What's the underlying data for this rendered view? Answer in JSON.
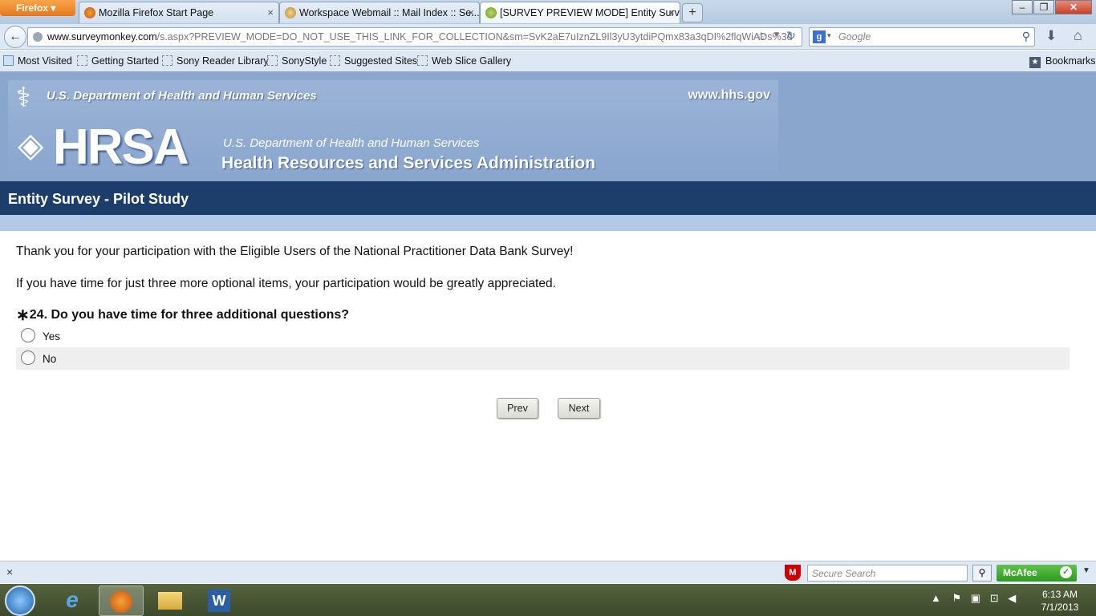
{
  "browser": {
    "menu_button": "Firefox",
    "tabs": [
      {
        "title": "Mozilla Firefox Start Page"
      },
      {
        "title": "Workspace Webmail :: Mail Index :: Se..."
      },
      {
        "title": "[SURVEY PREVIEW MODE] Entity Surv..."
      }
    ],
    "url_host": "www.surveymonkey.com",
    "url_path": "/s.aspx?PREVIEW_MODE=DO_NOT_USE_THIS_LINK_FOR_COLLECTION&sm=SvK2aE7uIznZL9Il3yU3ytdiPQmx83a3qDI%2flqWiADs%3d",
    "search_placeholder": "Google",
    "bookmarks": [
      "Most Visited",
      "Getting Started",
      "Sony Reader Library",
      "SonyStyle",
      "Suggested Sites",
      "Web Slice Gallery"
    ],
    "bookmarks_menu": "Bookmarks"
  },
  "header": {
    "dept": "U.S. Department of Health and Human Services",
    "site": "www.hhs.gov",
    "logo_text": "HRSA",
    "sub1": "U.S. Department of Health and Human Services",
    "sub2": "Health Resources and Services Administration"
  },
  "survey": {
    "title": "Entity Survey - Pilot Study",
    "intro1": "Thank you for your participation with the Eligible Users of the National Practitioner Data Bank Survey!",
    "intro2": "If you have time for just three more optional items, your participation would be greatly appreciated.",
    "required_mark": "∗",
    "question": "24. Do you have time for three additional questions?",
    "options": [
      "Yes",
      "No"
    ],
    "prev": "Prev",
    "next": "Next"
  },
  "addon_bar": {
    "secure_search_placeholder": "Secure Search",
    "mcafee": "McAfee"
  },
  "taskbar": {
    "time": "6:13 AM",
    "date": "7/1/2013"
  }
}
